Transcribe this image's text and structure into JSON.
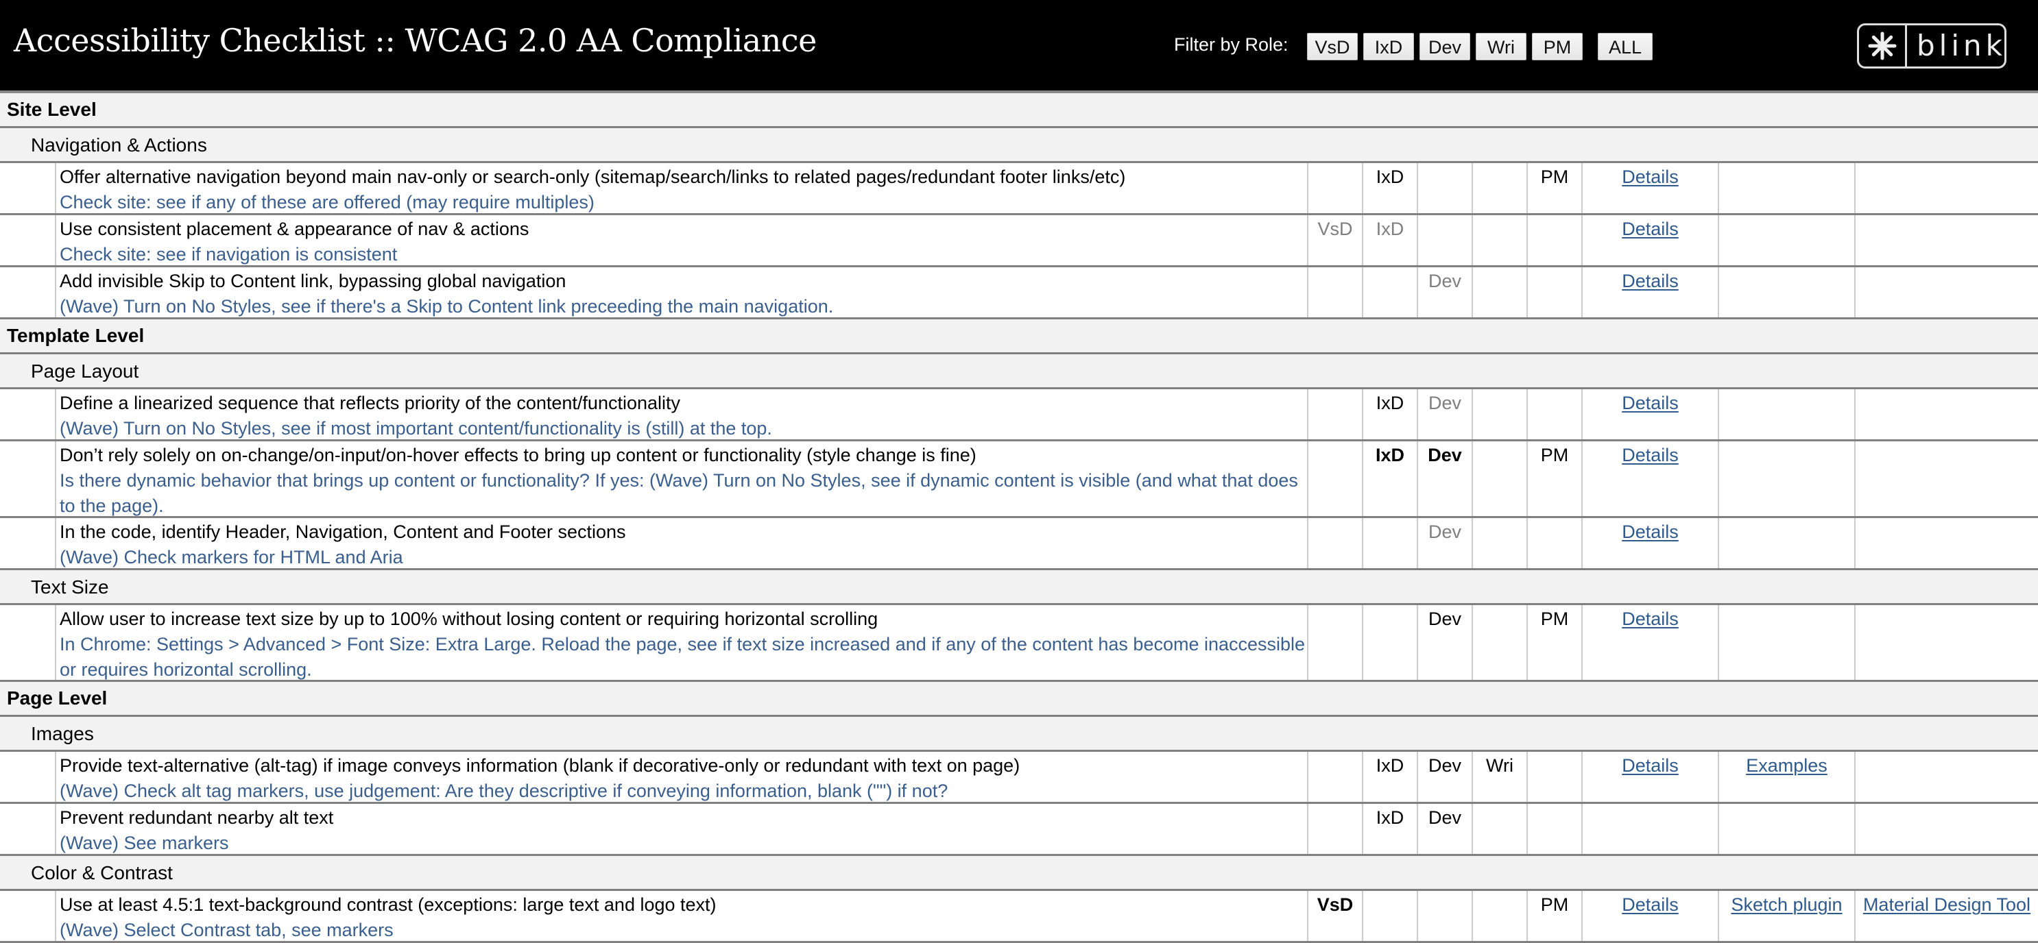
{
  "header": {
    "title": "Accessibility Checklist :: WCAG 2.0 AA Compliance",
    "filter_label": "Filter by Role:",
    "filter_buttons": [
      {
        "label": "VsD"
      },
      {
        "label": "IxD"
      },
      {
        "label": "Dev"
      },
      {
        "label": "Wri"
      },
      {
        "label": "PM"
      },
      {
        "label": "ALL"
      }
    ],
    "logo": {
      "text": "blink",
      "icon": "asterisk-icon"
    }
  },
  "colors": {
    "header_bg": "#000000",
    "section_bg": "#f2f2f2",
    "check_text": "#3a5f8f",
    "link": "#2f5a8e",
    "role_secondary": "#7f7f7f"
  },
  "role_columns": [
    "VsD",
    "IxD",
    "Dev",
    "Wri",
    "PM"
  ],
  "sections": [
    {
      "level": "Site Level",
      "groups": [
        {
          "name": "Navigation & Actions",
          "items": [
            {
              "title": "Offer alternative navigation beyond main nav-only or search-only (sitemap/search/links to related pages/redundant footer links/etc)",
              "check": "Check site: see if any of these are offered (may require multiples)",
              "roles": {
                "VsD": "",
                "IxD": "primary",
                "Dev": "",
                "Wri": "",
                "PM": "primary"
              },
              "links": [
                "Details",
                "",
                ""
              ]
            },
            {
              "title": "Use consistent placement & appearance of nav & actions",
              "check": "Check site: see if navigation is consistent",
              "roles": {
                "VsD": "secondary",
                "IxD": "secondary",
                "Dev": "",
                "Wri": "",
                "PM": ""
              },
              "links": [
                "Details",
                "",
                ""
              ]
            },
            {
              "title": "Add invisible Skip to Content link, bypassing global navigation",
              "check": "(Wave) Turn on No Styles, see if there's a Skip to Content link preceeding the main navigation.",
              "roles": {
                "VsD": "",
                "IxD": "",
                "Dev": "secondary",
                "Wri": "",
                "PM": ""
              },
              "links": [
                "Details",
                "",
                ""
              ]
            }
          ]
        }
      ]
    },
    {
      "level": "Template Level",
      "groups": [
        {
          "name": "Page Layout",
          "items": [
            {
              "title": "Define a linearized sequence that reflects priority of the content/functionality",
              "check": "(Wave) Turn on No Styles, see if most important content/functionality is (still) at the top.",
              "roles": {
                "VsD": "",
                "IxD": "primary",
                "Dev": "secondary",
                "Wri": "",
                "PM": ""
              },
              "links": [
                "Details",
                "",
                ""
              ]
            },
            {
              "title": "Don’t rely solely on on-change/on-input/on-hover effects to bring up content or functionality (style change is fine)",
              "check": "Is there dynamic behavior that brings up content or functionality? If yes: (Wave) Turn on No Styles, see if dynamic content is visible (and what that does to the page).",
              "roles": {
                "VsD": "",
                "IxD": "bold",
                "Dev": "bold",
                "Wri": "",
                "PM": "primary"
              },
              "links": [
                "Details",
                "",
                ""
              ]
            },
            {
              "title": "In the code, identify Header, Navigation, Content and Footer sections",
              "check": "(Wave) Check markers for HTML and Aria",
              "roles": {
                "VsD": "",
                "IxD": "",
                "Dev": "secondary",
                "Wri": "",
                "PM": ""
              },
              "links": [
                "Details",
                "",
                ""
              ]
            }
          ]
        },
        {
          "name": "Text Size",
          "items": [
            {
              "title": "Allow user to increase text size by up to 100% without losing content or requiring horizontal scrolling",
              "check": "In Chrome: Settings > Advanced > Font Size: Extra Large. Reload the page, see if text size increased and if any of the content has become inaccessible or requires horizontal scrolling.",
              "roles": {
                "VsD": "",
                "IxD": "",
                "Dev": "primary",
                "Wri": "",
                "PM": "primary"
              },
              "links": [
                "Details",
                "",
                ""
              ]
            }
          ]
        }
      ]
    },
    {
      "level": "Page Level",
      "groups": [
        {
          "name": "Images",
          "items": [
            {
              "title": "Provide text-alternative (alt-tag) if image conveys information (blank if decorative-only or redundant with text on page)",
              "check": "(Wave) Check alt tag markers, use judgement: Are they descriptive if conveying information, blank (\"\") if not?",
              "roles": {
                "VsD": "",
                "IxD": "primary",
                "Dev": "primary",
                "Wri": "primary",
                "PM": ""
              },
              "links": [
                "Details",
                "Examples",
                ""
              ]
            },
            {
              "title": "Prevent redundant nearby alt text",
              "check": "(Wave) See markers",
              "roles": {
                "VsD": "",
                "IxD": "primary",
                "Dev": "primary",
                "Wri": "",
                "PM": ""
              },
              "links": [
                "",
                "",
                ""
              ]
            }
          ]
        },
        {
          "name": "Color & Contrast",
          "items": [
            {
              "title": "Use at least 4.5:1 text-background contrast (exceptions: large text and logo text)",
              "check": "(Wave) Select Contrast tab, see markers",
              "roles": {
                "VsD": "bold",
                "IxD": "",
                "Dev": "",
                "Wri": "",
                "PM": "primary"
              },
              "links": [
                "Details",
                "Sketch plugin",
                "Material Design Tool"
              ]
            }
          ]
        }
      ]
    }
  ]
}
